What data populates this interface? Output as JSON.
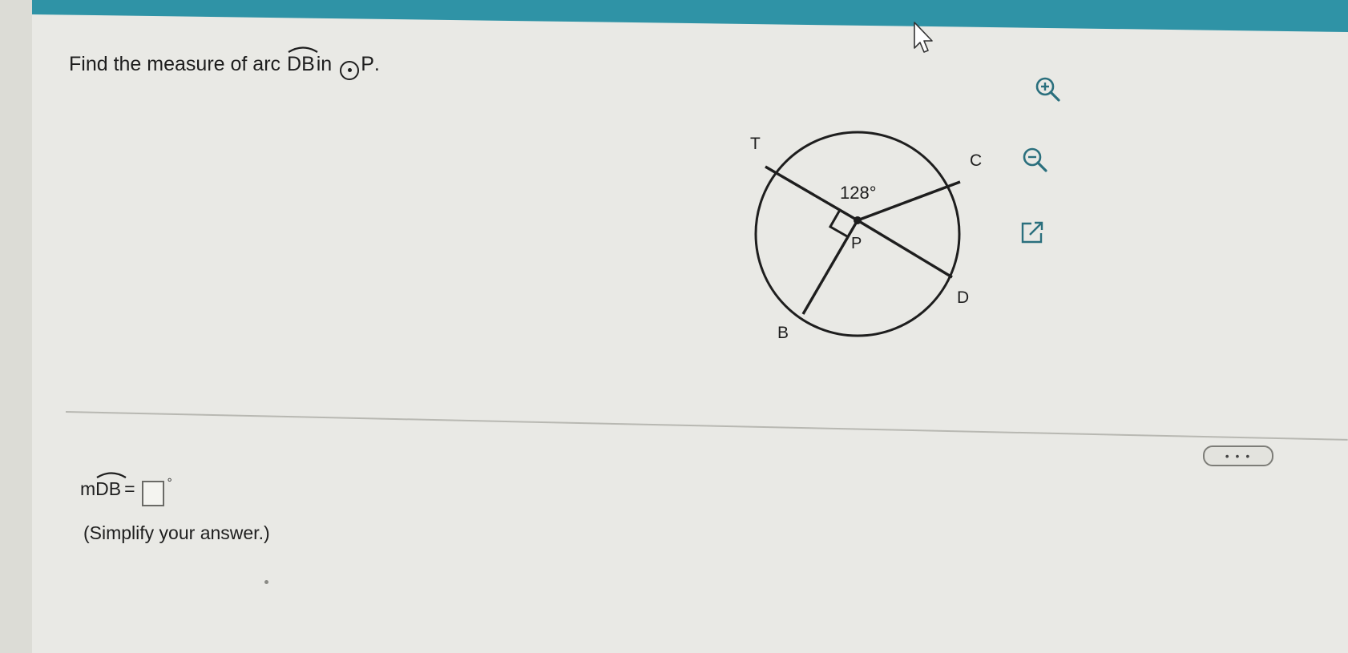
{
  "question": {
    "prefix": "Find the measure of arc",
    "arc": "DB",
    "middle": "in",
    "circle": "P",
    "suffix": "."
  },
  "toolbar": {
    "zoom_in_icon": "zoom-in-icon",
    "zoom_out_icon": "zoom-out-icon",
    "expand_icon": "external-link-icon"
  },
  "diagram": {
    "points": {
      "T": "T",
      "C": "C",
      "D": "D",
      "B": "B",
      "P": "P"
    },
    "angle_label": "128°",
    "right_angle": true
  },
  "more_button": {
    "label": "• • •"
  },
  "answer": {
    "prefix": "m",
    "arc": "DB",
    "equals": "=",
    "value": "",
    "unit": "°"
  },
  "hint": "(Simplify your answer.)",
  "colors": {
    "header": "#2f93a6",
    "background": "#e9e9e5",
    "ink": "#1e1e1e"
  }
}
